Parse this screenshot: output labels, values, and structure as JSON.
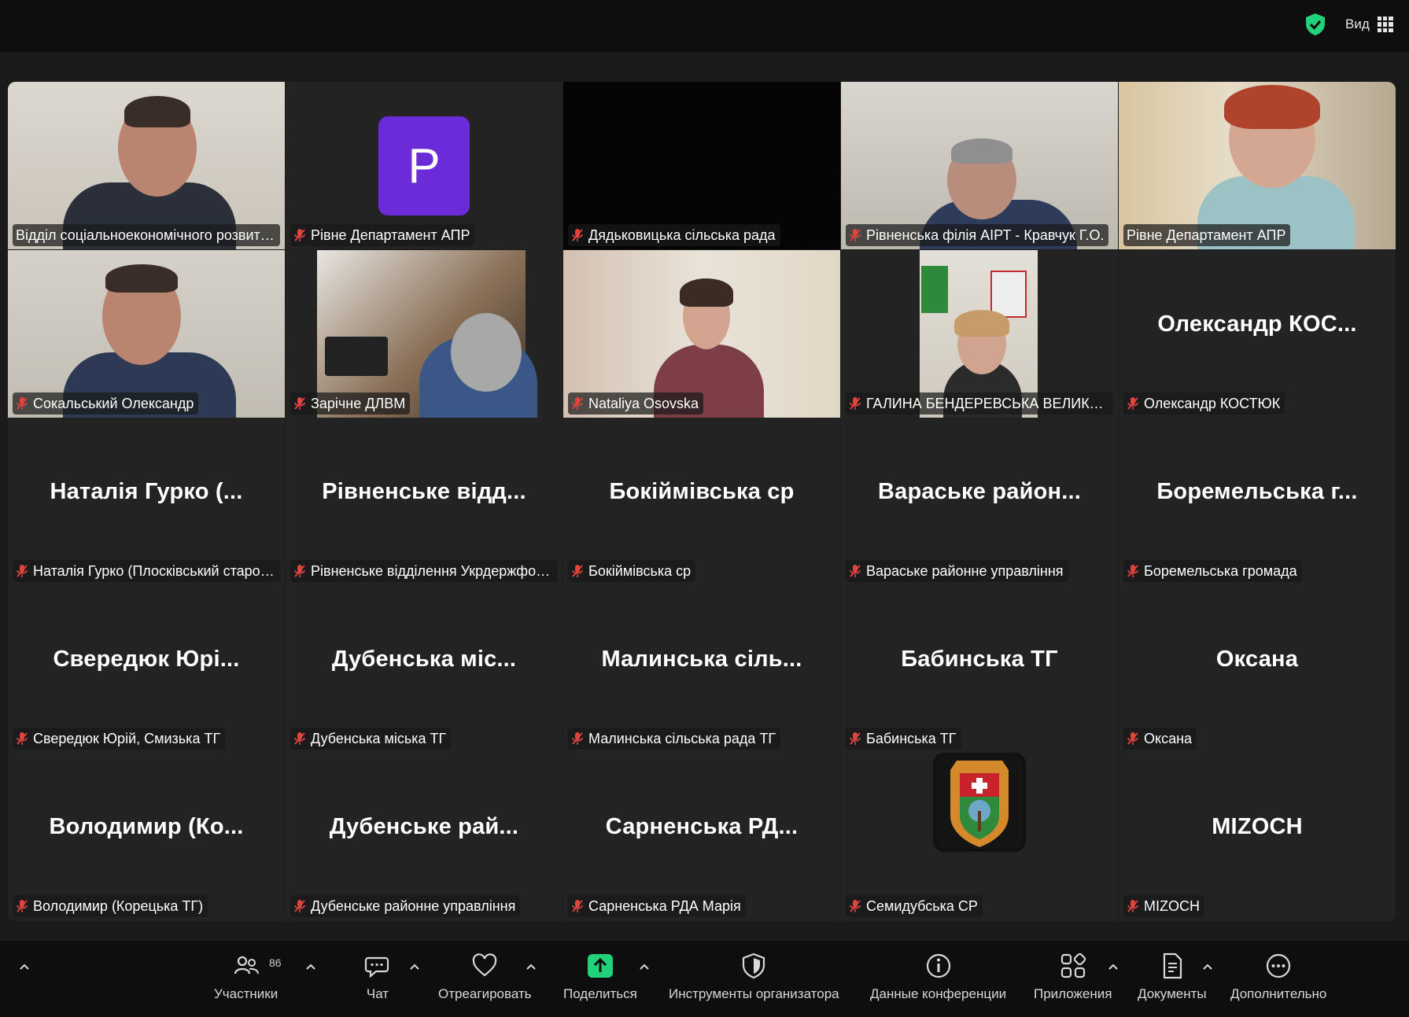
{
  "header": {
    "view_label": "Вид"
  },
  "tiles": [
    {
      "label": "Відділ соціальноекономічного розвитк...",
      "big": ""
    },
    {
      "label": "Рівне Департамент АПР",
      "big": "",
      "avatar_letter": "P"
    },
    {
      "label": "Дядьковицька сільська рада",
      "big": ""
    },
    {
      "label": "Рівненська філія АІРТ - Кравчук Г.О.",
      "big": ""
    },
    {
      "label": "Рівне Департамент АПР",
      "big": ""
    },
    {
      "label": "Сокальський Олександр",
      "big": ""
    },
    {
      "label": "Зарічне ДЛВМ",
      "big": ""
    },
    {
      "label": "Nataliya Osovska",
      "big": ""
    },
    {
      "label": "ГАЛИНА БЕНДЕРЕВСЬКА ВЕЛИКОО...",
      "big": ""
    },
    {
      "label": "Олександр КОСТЮК",
      "big": "Олександр  КОС..."
    },
    {
      "label": "Наталія Гурко (Плосківський старос...",
      "big": "Наталія Гурко (..."
    },
    {
      "label": "Рівненське відділення Укрдержфон...",
      "big": "Рівненське  відд..."
    },
    {
      "label": "Бокіймівська ср",
      "big": "Бокіймівська ср"
    },
    {
      "label": "Вараське районне управління",
      "big": "Вараське  район..."
    },
    {
      "label": "Боремельська громада",
      "big": "Боремельська  г..."
    },
    {
      "label": "Свередюк Юрій, Смизька ТГ",
      "big": "Свередюк  Юрі..."
    },
    {
      "label": "Дубенська міська ТГ",
      "big": "Дубенська  міс..."
    },
    {
      "label": "Малинська сільська рада ТГ",
      "big": "Малинська  сіль..."
    },
    {
      "label": "Бабинська ТГ",
      "big": "Бабинська ТГ"
    },
    {
      "label": "Оксана",
      "big": "Оксана"
    },
    {
      "label": "Володимир (Корецька ТГ)",
      "big": "Володимир  (Ко..."
    },
    {
      "label": "Дубенське районне управління",
      "big": "Дубенське  рай..."
    },
    {
      "label": "Сарненська РДА Марія",
      "big": "Сарненська  РД..."
    },
    {
      "label": "Семидубська СР",
      "big": ""
    },
    {
      "label": "MIZOCH",
      "big": "MIZOCH"
    }
  ],
  "toolbar": {
    "participants_label": "Участники",
    "participants_count": "86",
    "chat_label": "Чат",
    "react_label": "Отреагировать",
    "share_label": "Поделиться",
    "host_tools_label": "Инструменты организатора",
    "meeting_info_label": "Данные конференции",
    "apps_label": "Приложения",
    "docs_label": "Документы",
    "more_label": "Дополнительно"
  },
  "colors": {
    "active_speaker": "#23d17a",
    "share_green": "#23d17a",
    "mute_red": "#e0443e",
    "avatar_purple": "#6b2bd9"
  }
}
